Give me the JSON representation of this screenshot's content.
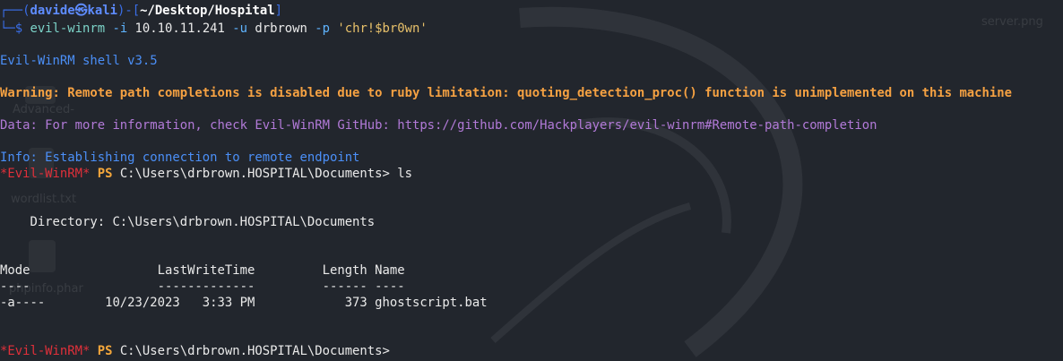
{
  "desktop": {
    "labels": [
      "server.png",
      "Advanced-",
      "wordlist.txt",
      "phpinfo.phar"
    ]
  },
  "prompt": {
    "open": "┌──(",
    "user": "davide",
    "at": "㉿",
    "host": "kali",
    "mid": ")-[",
    "path": "~/Desktop/Hospital",
    "close": "]",
    "line2_prefix": "└─$ ",
    "command": "evil-winrm",
    "flag_i": " -i ",
    "ip": "10.10.11.241",
    "flag_u": " -u ",
    "user_arg": "drbrown",
    "flag_p": " -p ",
    "password": "'chr!$br0wn'"
  },
  "output": {
    "shell_version": "Evil-WinRM shell v3.5",
    "warning": "Warning: Remote path completions is disabled due to ruby limitation: quoting_detection_proc() function is unimplemented on this machine",
    "data": "Data: For more information, check Evil-WinRM GitHub: https://github.com/Hackplayers/evil-winrm#Remote-path-completion",
    "info": "Info: Establishing connection to remote endpoint"
  },
  "ps_prompt": {
    "tag": "*Evil-WinRM*",
    "ps": " PS ",
    "cwd": "C:\\Users\\drbrown.HOSPITAL\\Documents>",
    "cmd1": " ls",
    "cmd2": ""
  },
  "listing": {
    "directory_line": "    Directory: C:\\Users\\drbrown.HOSPITAL\\Documents",
    "header": "Mode                 LastWriteTime         Length Name",
    "separator": "----                 -------------         ------ ----",
    "rows": [
      "-a----        10/23/2023   3:33 PM            373 ghostscript.bat"
    ]
  }
}
